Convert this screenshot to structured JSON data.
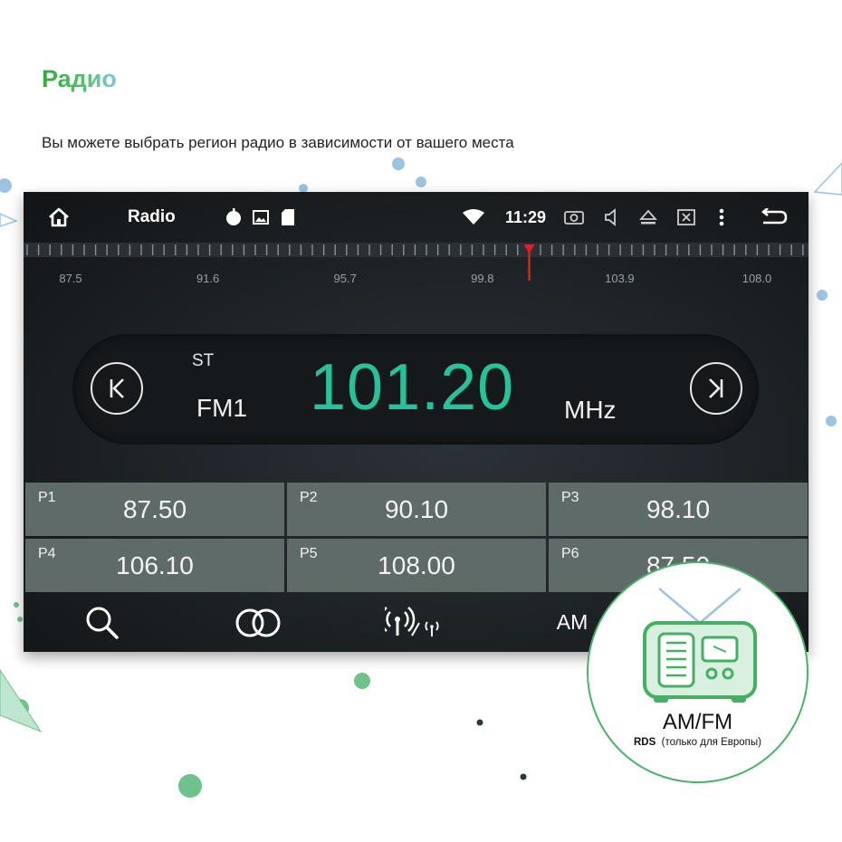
{
  "page": {
    "title": "Радио",
    "subtitle": "Вы можете выбрать регион радио в зависимости от вашего места"
  },
  "statusbar": {
    "home_icon": "home-icon",
    "app_title": "Radio",
    "notification_icons": [
      "app-icon",
      "image-icon",
      "sd-card-icon"
    ],
    "wifi_icon": "wifi-icon",
    "time": "11:29",
    "right_icons": [
      "screenshot-icon",
      "volume-icon",
      "eject-icon",
      "close-window-icon",
      "more-icon",
      "back-icon"
    ]
  },
  "tuner": {
    "scale_labels": [
      "87.5",
      "91.6",
      "95.7",
      "99.8",
      "103.9",
      "108.0"
    ],
    "scale_min": 87.5,
    "scale_max": 108.0,
    "needle_value": 101.2
  },
  "station": {
    "stereo": "ST",
    "band": "FM1",
    "frequency": "101.20",
    "unit": "MHz",
    "prev_icon": "seek-previous-icon",
    "next_icon": "seek-next-icon"
  },
  "presets": [
    {
      "name": "P1",
      "freq": "87.50"
    },
    {
      "name": "P2",
      "freq": "90.10"
    },
    {
      "name": "P3",
      "freq": "98.10"
    },
    {
      "name": "P4",
      "freq": "106.10"
    },
    {
      "name": "P5",
      "freq": "108.00"
    },
    {
      "name": "P6",
      "freq": "87.50"
    }
  ],
  "bottombar": {
    "search_icon": "search-icon",
    "stereo_icon": "stereo-rings-icon",
    "local_dx_icon": "antenna-signal-icon",
    "band_button": "AM"
  },
  "badge": {
    "icon": "retro-radio-icon",
    "title": "AM/FM",
    "note_bold": "RDS",
    "note": "(только для Европы)"
  },
  "colors": {
    "frequency": "#27c29a",
    "preset_bg": "#5e6b68",
    "needle": "#e02020",
    "accent_green": "#4bb06a"
  }
}
